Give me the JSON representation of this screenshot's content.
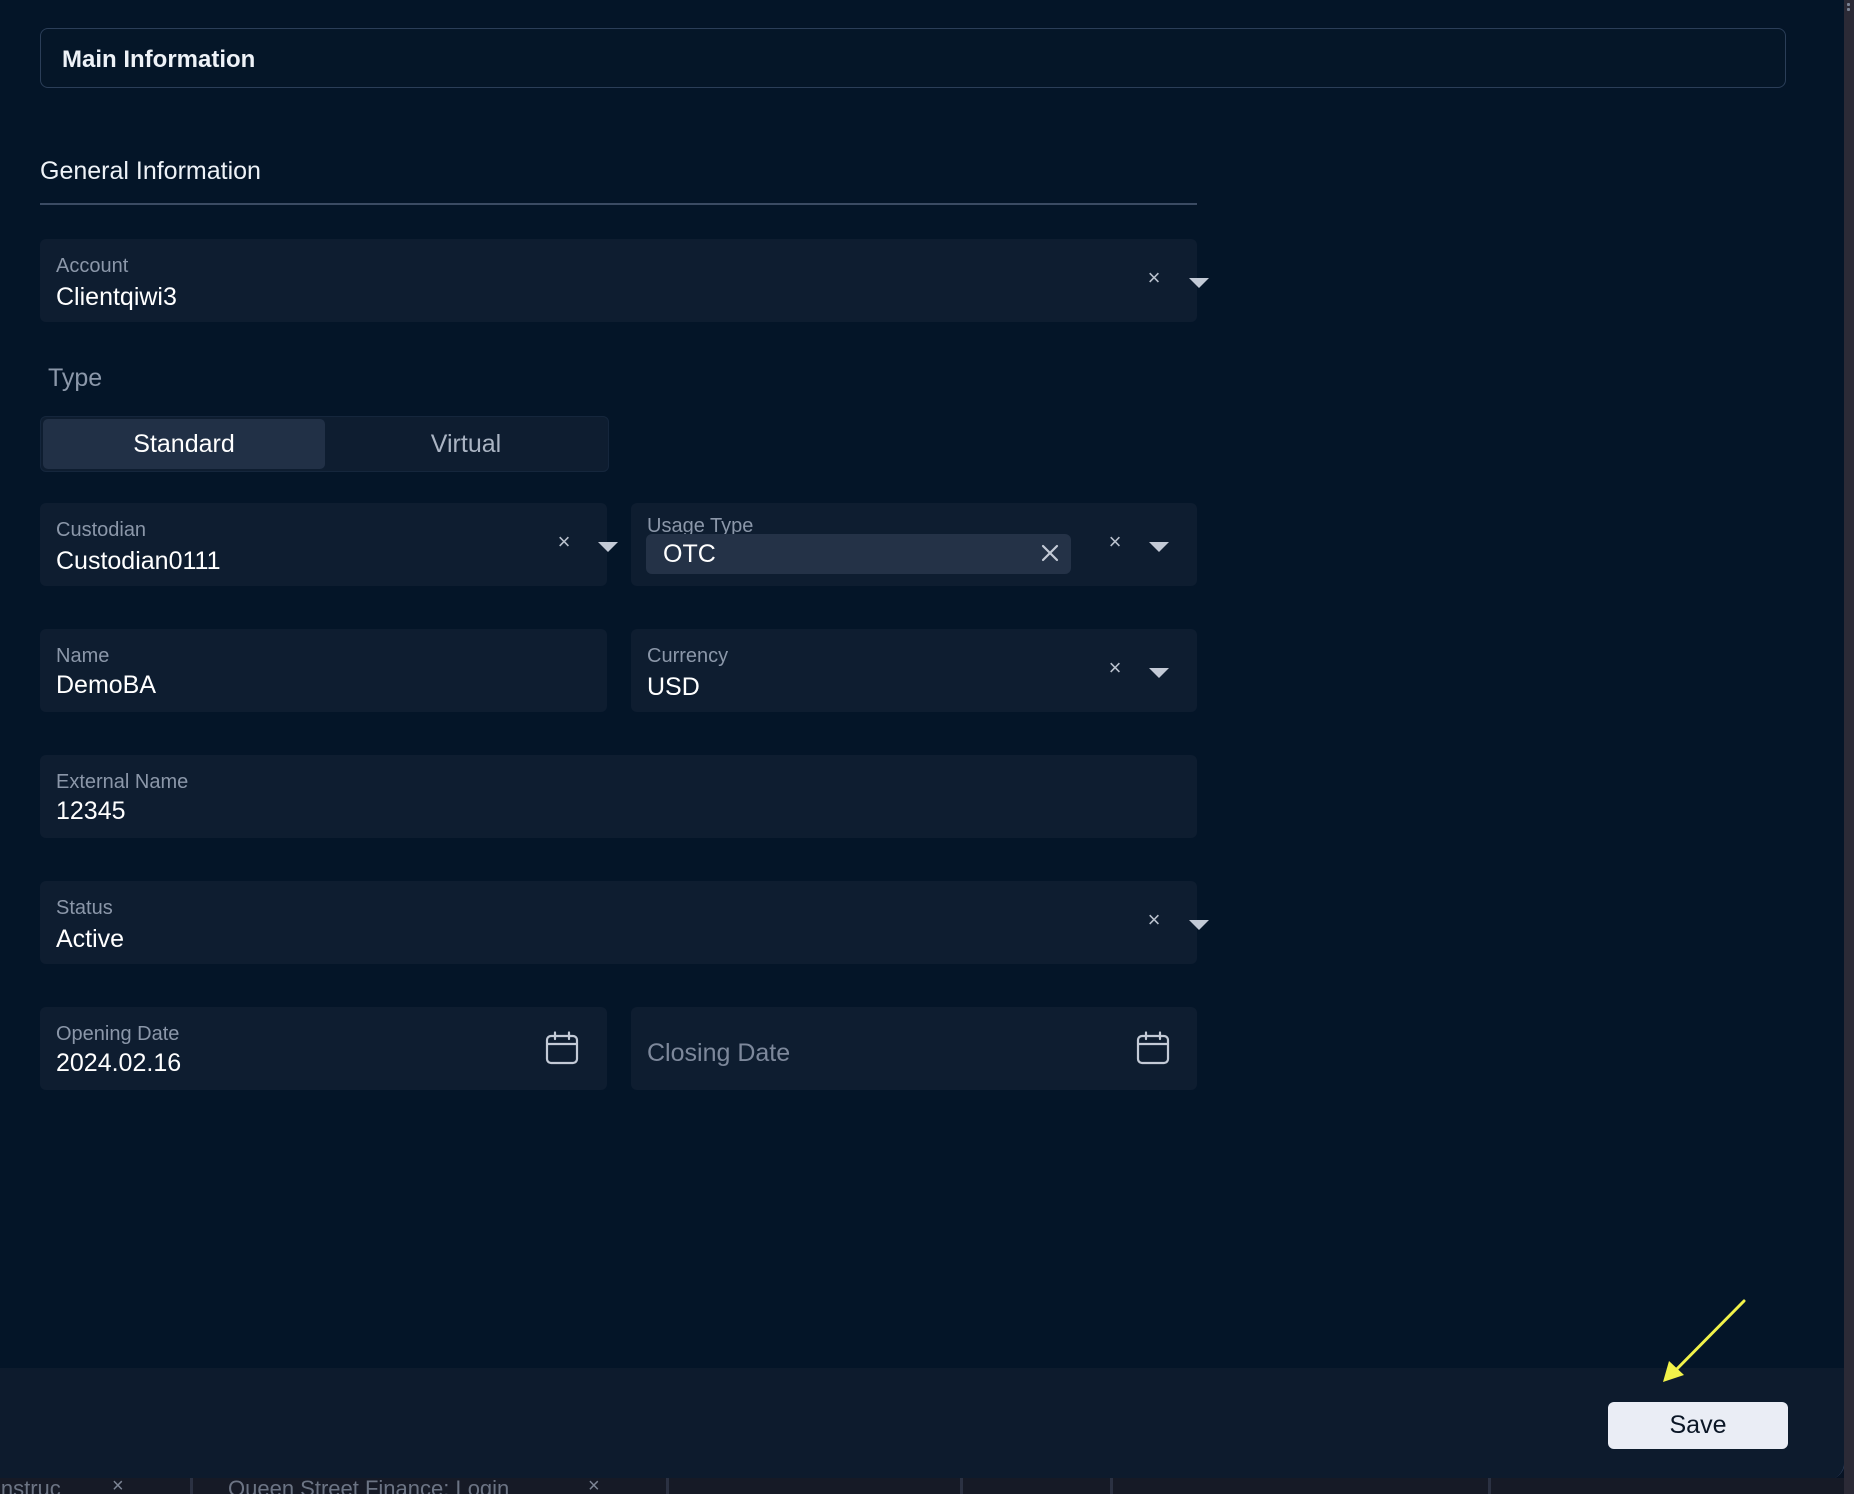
{
  "header": {
    "title": "Main Information"
  },
  "section": {
    "title": "General Information"
  },
  "account": {
    "label": "Account",
    "value": "Clientqiwi3"
  },
  "type": {
    "label": "Type",
    "options": [
      "Standard",
      "Virtual"
    ],
    "selected": "Standard"
  },
  "custodian": {
    "label": "Custodian",
    "value": "Custodian0111"
  },
  "usage_type": {
    "label": "Usage Type",
    "chips": [
      "OTC"
    ]
  },
  "name": {
    "label": "Name",
    "value": "DemoBA"
  },
  "currency": {
    "label": "Currency",
    "value": "USD"
  },
  "external_name": {
    "label": "External Name",
    "value": "12345"
  },
  "status": {
    "label": "Status",
    "value": "Active"
  },
  "opening_date": {
    "label": "Opening Date",
    "value": "2024.02.16"
  },
  "closing_date": {
    "placeholder": "Closing Date"
  },
  "footer": {
    "save_label": "Save"
  },
  "taskbar": {
    "tab1": "instruc",
    "tab2": "Queen Street Finance: Login"
  },
  "colors": {
    "background": "#041528",
    "field_background": "#0e1d30",
    "label": "#8b97a9",
    "save_button": "#eaedf5",
    "annotation_arrow": "#f2f24a"
  },
  "icons": {
    "clear": "clear-icon",
    "dropdown": "chevron-down-icon",
    "calendar": "calendar-icon",
    "chip_remove": "close-icon"
  }
}
